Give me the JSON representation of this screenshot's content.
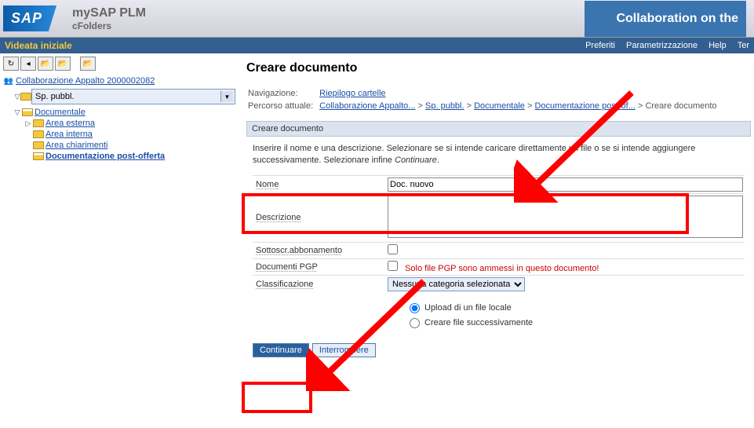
{
  "header": {
    "logo": "SAP",
    "title1": "mySAP PLM",
    "title2": "cFolders",
    "tagline": "Collaboration on the"
  },
  "topmenu": {
    "left": "Videata iniziale",
    "items": [
      "Preferiti",
      "Parametrizzazione",
      "Help",
      "Ter"
    ]
  },
  "tree": {
    "root": "Collaborazione Appalto 2000002082",
    "dropdown": "Sp. pubbl.",
    "nodes": [
      {
        "label": "Documentale",
        "level": 1,
        "open": true
      },
      {
        "label": "Area esterna",
        "level": 2
      },
      {
        "label": "Area interna",
        "level": 2
      },
      {
        "label": "Area chiarimenti",
        "level": 2
      },
      {
        "label": "Documentazione post-offerta",
        "level": 2,
        "selected": true
      }
    ]
  },
  "page": {
    "title": "Creare documento",
    "nav_label": "Navigazione:",
    "nav_link": "Riepilogo cartelle",
    "path_label": "Percorso attuale:",
    "crumbs": [
      "Collaborazione Appalto...",
      "Sp. pubbl.",
      "Documentale",
      "Documentazione post-of..."
    ],
    "crumb_final": "Creare documento",
    "section_title": "Creare documento",
    "instruction": "Inserire il nome e una descrizione. Selezionare se si intende caricare direttamente un file o se si intende aggiungere successivamente. Selezionare infine",
    "instruction_em": "Continuare",
    "fields": {
      "name_label": "Nome",
      "name_value": "Doc. nuovo",
      "desc_label": "Descrizione",
      "desc_value": "",
      "sub_label": "Sottoscr.abbonamento",
      "pgp_label": "Documenti PGP",
      "pgp_warn": "Solo file PGP sono ammessi in questo documento!",
      "class_label": "Classificazione",
      "class_value": "Nessuna categoria selezionata"
    },
    "radios": {
      "opt1": "Upload di un file locale",
      "opt2": "Creare file successivamente"
    },
    "buttons": {
      "continue": "Continuare",
      "cancel": "Interrompere"
    }
  }
}
